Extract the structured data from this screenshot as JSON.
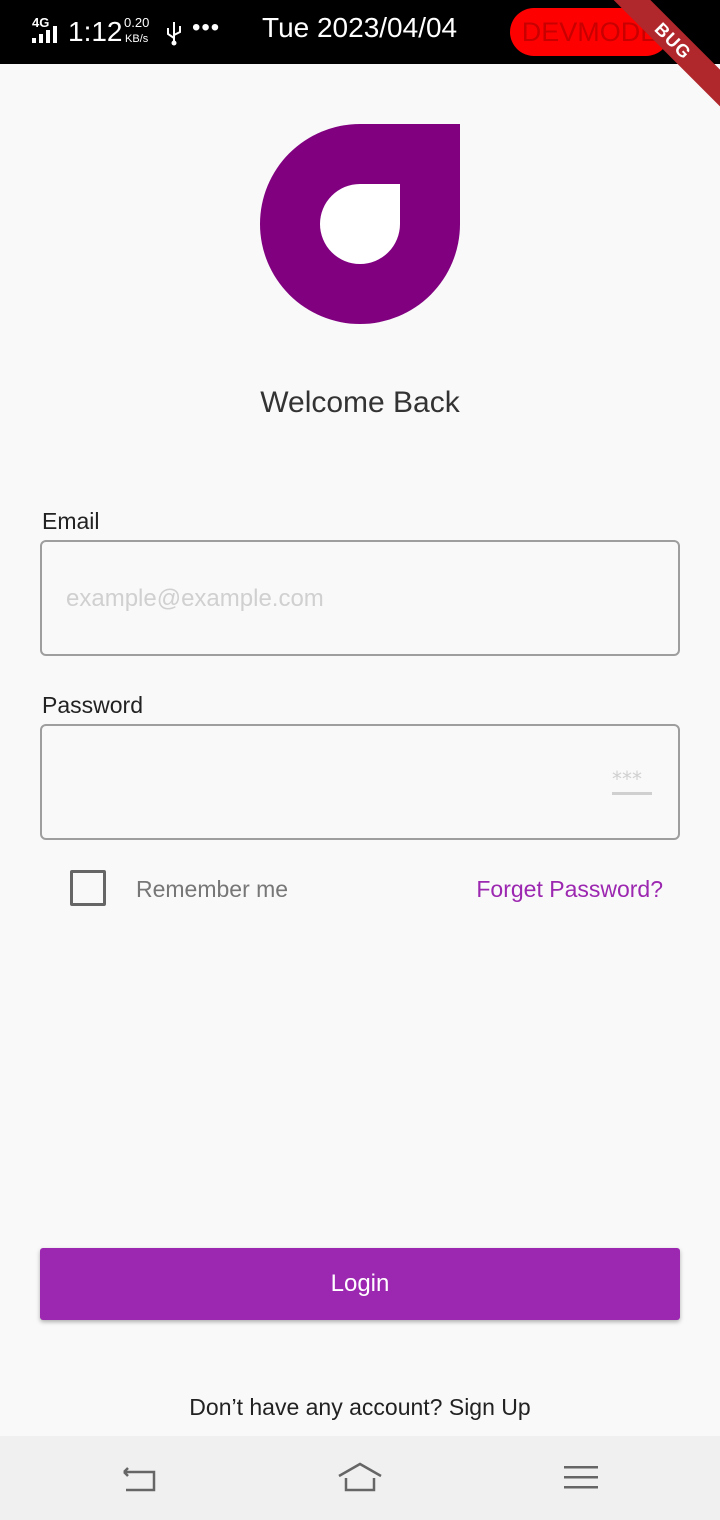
{
  "status_bar": {
    "network": "4G",
    "time": "1:12",
    "speed_value": "0.20",
    "speed_unit": "KB/s",
    "more": "•••",
    "date": "Tue 2023/04/04",
    "devmode_label": "DEVMODE",
    "debug_banner": "BUG"
  },
  "colors": {
    "accent": "#9c27b0",
    "logo": "#800080"
  },
  "welcome_title": "Welcome Back",
  "email": {
    "label": "Email",
    "placeholder": "example@example.com",
    "value": ""
  },
  "password": {
    "label": "Password",
    "value": "",
    "toggle_icon": "password-visibility-icon"
  },
  "remember_me": {
    "label": "Remember me",
    "checked": false
  },
  "forget_password": "Forget Password?",
  "login_button": "Login",
  "signup_prompt": "Don’t have any account? Sign Up",
  "nav_bar": {
    "back_icon": "back-icon",
    "home_icon": "home-icon",
    "menu_icon": "menu-icon"
  }
}
